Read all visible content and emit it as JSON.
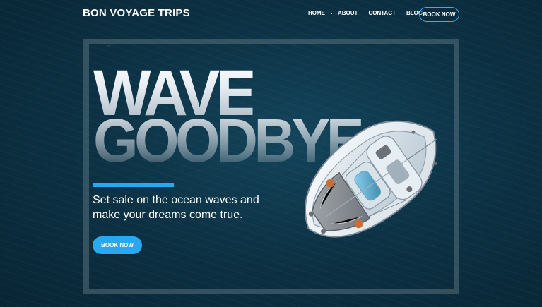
{
  "brand": {
    "name": "BON VOYAGE TRIPS"
  },
  "nav": {
    "items": [
      {
        "label": "HOME"
      },
      {
        "label": "ABOUT"
      },
      {
        "label": "CONTACT"
      },
      {
        "label": "BLOG"
      }
    ],
    "cta": "BOOK NOW"
  },
  "hero": {
    "headline_line_1": "WAVE",
    "headline_line_2": "GOODBYE",
    "subtitle": "Set sale on the ocean waves and make your dreams come true.",
    "cta": "BOOK NOW"
  },
  "colors": {
    "accent": "#29A7EF",
    "text": "#FFFFFF",
    "ocean": "#0F2F40"
  },
  "icons": {
    "nav_separator": "dot-icon"
  }
}
